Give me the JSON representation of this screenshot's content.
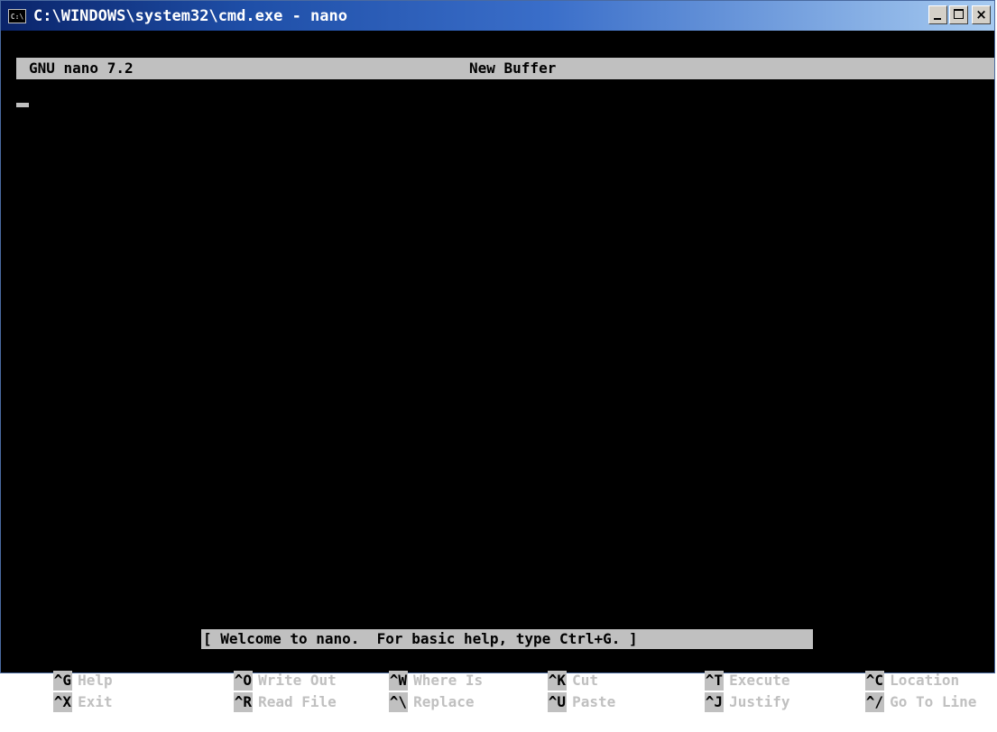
{
  "window": {
    "title": "C:\\WINDOWS\\system32\\cmd.exe - nano",
    "icon_text": "C:\\",
    "close_glyph": "×"
  },
  "nano": {
    "version": "GNU nano 7.2",
    "buffer": "New Buffer",
    "status_message": "[ Welcome to nano.  For basic help, type Ctrl+G. ]"
  },
  "shortcuts": [
    {
      "key": "^G",
      "label": "Help"
    },
    {
      "key": "^O",
      "label": "Write Out"
    },
    {
      "key": "^W",
      "label": "Where Is"
    },
    {
      "key": "^K",
      "label": "Cut"
    },
    {
      "key": "^T",
      "label": "Execute"
    },
    {
      "key": "^C",
      "label": "Location"
    },
    {
      "key": "^X",
      "label": "Exit"
    },
    {
      "key": "^R",
      "label": "Read File"
    },
    {
      "key": "^\\",
      "label": "Replace"
    },
    {
      "key": "^U",
      "label": "Paste"
    },
    {
      "key": "^J",
      "label": "Justify"
    },
    {
      "key": "^/",
      "label": "Go To Line"
    }
  ],
  "colors": {
    "console_bg": "#000000",
    "console_fg": "#c0c0c0",
    "titlebar_start": "#0a246a",
    "titlebar_end": "#a6caf0"
  }
}
